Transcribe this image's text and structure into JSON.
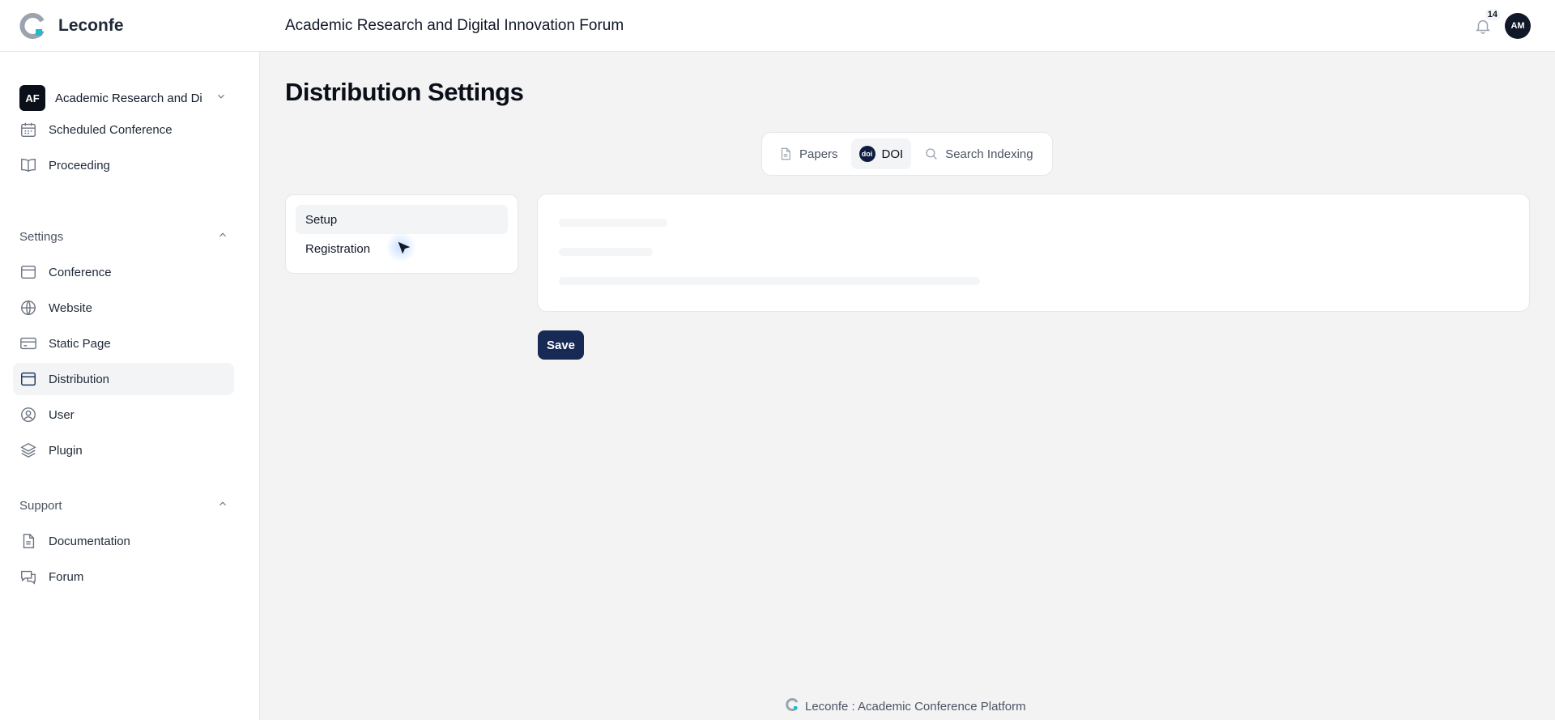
{
  "app": {
    "brand": "Leconfe",
    "conference_title": "Academic Research and Digital Innovation Forum",
    "notification_count": "14",
    "user_initials": "AM"
  },
  "sidebar": {
    "conference_badge": "AF",
    "conference_name": "Academic Research and Di",
    "top_items": [
      {
        "label": "Scheduled Conference",
        "icon": "calendar-icon"
      },
      {
        "label": "Proceeding",
        "icon": "book-open-icon"
      }
    ],
    "settings": {
      "label": "Settings",
      "items": [
        {
          "label": "Conference",
          "icon": "window-icon"
        },
        {
          "label": "Website",
          "icon": "globe-icon"
        },
        {
          "label": "Static Page",
          "icon": "card-icon"
        },
        {
          "label": "Distribution",
          "icon": "window-icon",
          "active": true
        },
        {
          "label": "User",
          "icon": "user-circle-icon"
        },
        {
          "label": "Plugin",
          "icon": "layers-icon"
        }
      ]
    },
    "support": {
      "label": "Support",
      "items": [
        {
          "label": "Documentation",
          "icon": "document-icon"
        },
        {
          "label": "Forum",
          "icon": "chat-bubbles-icon"
        }
      ]
    }
  },
  "main": {
    "title": "Distribution Settings",
    "tabs": [
      {
        "label": "Papers",
        "icon": "document-icon"
      },
      {
        "label": "DOI",
        "icon": "doi-icon",
        "active": true
      },
      {
        "label": "Search Indexing",
        "icon": "search-icon"
      }
    ],
    "subnav": [
      {
        "label": "Setup",
        "active": true
      },
      {
        "label": "Registration"
      }
    ],
    "save_label": "Save"
  },
  "footer": {
    "text": "Leconfe : Academic Conference Platform"
  },
  "colors": {
    "primary_button": "#172a55",
    "doi_badge": "#0e1d3f",
    "logo_accent": "#22b8cf",
    "background": "#f3f3f4"
  }
}
